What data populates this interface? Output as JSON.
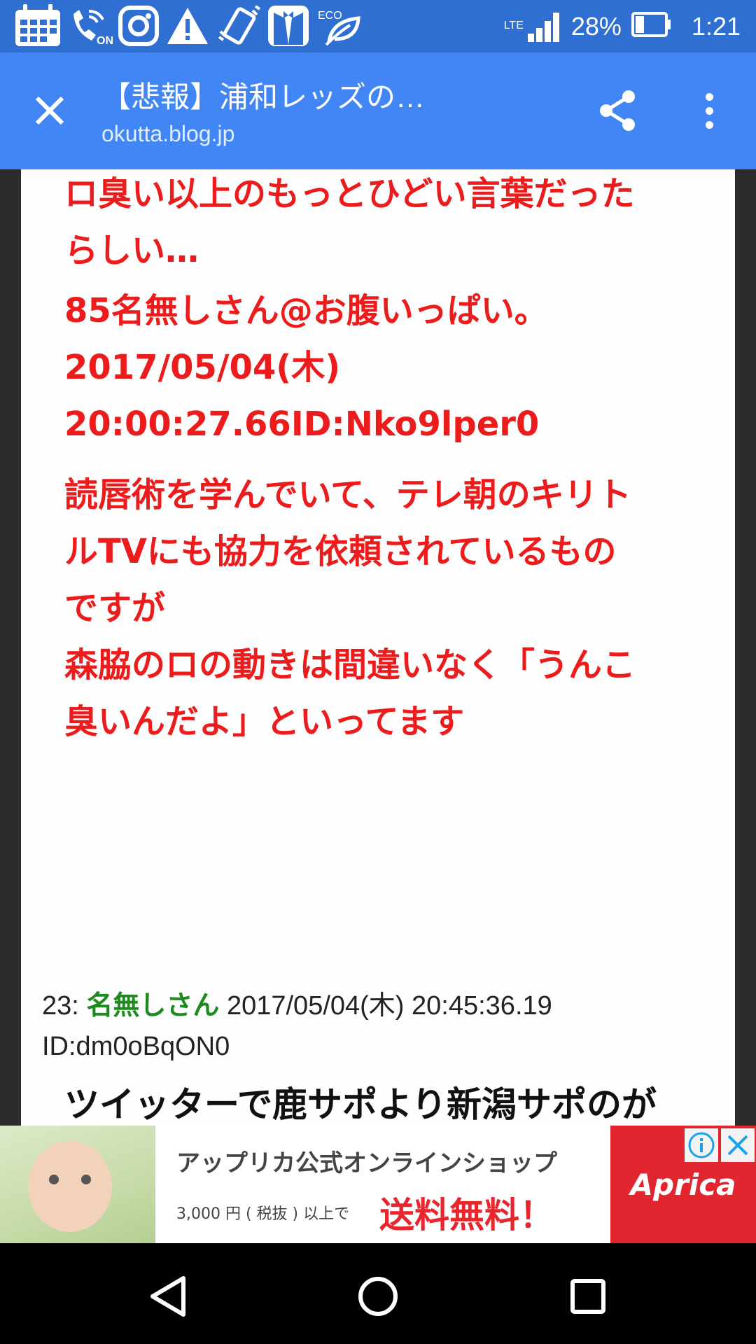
{
  "status_bar": {
    "icons": [
      "calendar-icon",
      "wifi-call-icon",
      "instagram-icon",
      "warning-icon",
      "phone-vibrate-icon",
      "tuxedo-icon",
      "eco-leaf-icon"
    ],
    "wifi_call_label": "ON",
    "eco_label": "ECO",
    "network": "LTE",
    "battery": "28%",
    "time": "1:21"
  },
  "app_bar": {
    "title": "【悲報】浦和レッズの…",
    "url": "okutta.blog.jp"
  },
  "content": {
    "paragraph1": [
      "ロ臭い以上のもっとひどい言葉だった",
      "らしい…"
    ],
    "quote_header": [
      "85名無しさん@お腹いっぱい。",
      "2017/05/04(木)",
      "20:00:27.66ID:Nko9lper0"
    ],
    "paragraph2": [
      "読唇術を学んでいて、テレ朝のキリト",
      "ルTVにも協力を依頼されているもの",
      "ですが",
      "森脇のロの動きは間違いなく「うんこ",
      "臭いんだよ」といってます"
    ],
    "post": {
      "number": "23:",
      "name": "名無しさん",
      "datetime": "2017/05/04(木) 20:45:36.19",
      "id": "ID:dm0oBqON0"
    },
    "cutoff_text": "ツイッターで鹿サポより新潟サポのが"
  },
  "ad": {
    "headline": "アップリカ公式オンラインショップ",
    "subline": "3,000 円 ( 税抜 ) 以上で",
    "highlight": "送料無料！",
    "brand": "Aprica"
  },
  "nav": {
    "buttons": [
      "back",
      "home",
      "recents"
    ]
  },
  "colors": {
    "status_bar": "#2f6fd1",
    "app_bar": "#4285f4",
    "body_text_red": "#ec1c1c",
    "poster_name_green": "#1c8a1c",
    "ad_brand_red": "#e2262f"
  }
}
